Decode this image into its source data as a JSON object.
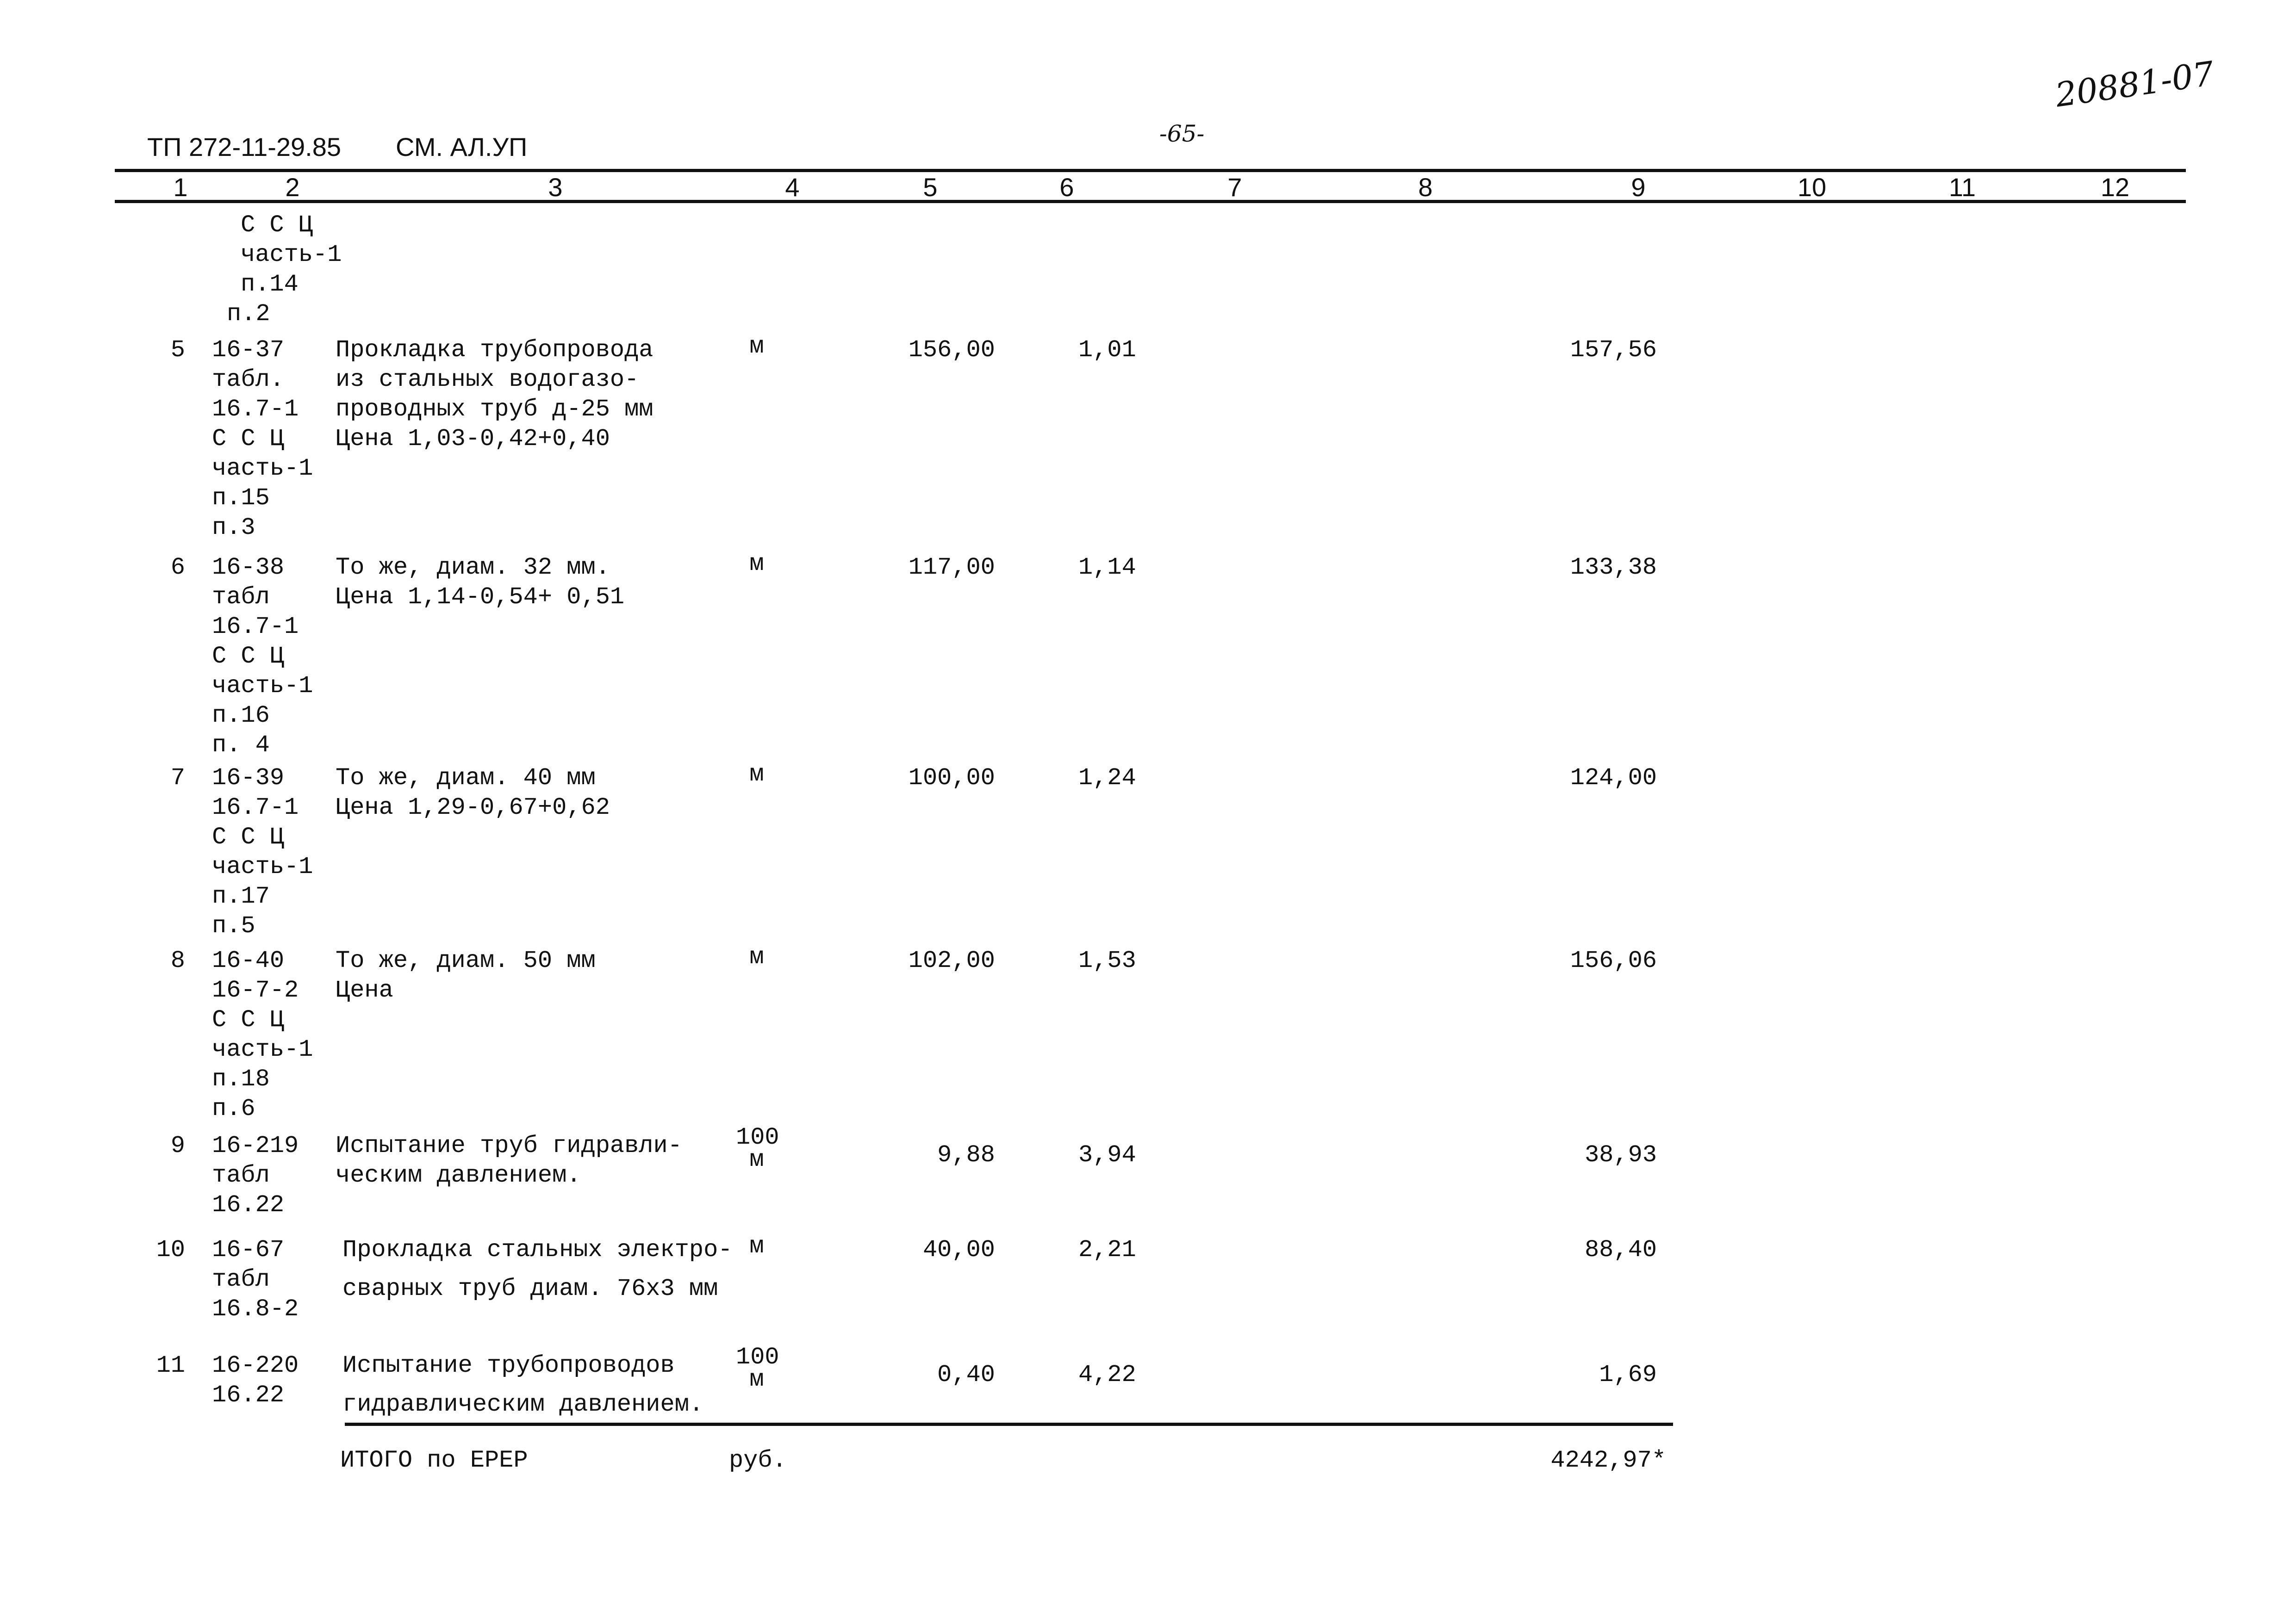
{
  "header": {
    "doc_code": "ТП 272-11-29.85",
    "section": "СМ. АЛ.УП",
    "page_number": "-65-",
    "archive_number": "20881-07"
  },
  "columns": [
    "1",
    "2",
    "3",
    "4",
    "5",
    "6",
    "7",
    "8",
    "9",
    "10",
    "11",
    "12"
  ],
  "continuation": {
    "ref_lines": [
      "С С Ц",
      "часть-1",
      "п.14",
      "п.2"
    ]
  },
  "rows": [
    {
      "num": "5",
      "ref_lines": [
        "16-37",
        "табл.",
        "16.7-1",
        "С С Ц",
        "часть-1",
        "п.15",
        "п.3"
      ],
      "desc_lines": [
        "Прокладка трубопровода",
        "из стальных водогазо-",
        "проводных труб д-25 мм",
        "Цена 1,03-0,42+0,40"
      ],
      "unit_lines": [
        "м"
      ],
      "qty": "156,00",
      "price": "1,01",
      "total": "157,56"
    },
    {
      "num": "6",
      "ref_lines": [
        "16-38",
        "табл",
        "16.7-1",
        "С С Ц",
        "часть-1",
        "п.16",
        "п. 4"
      ],
      "desc_lines": [
        "То же, диам. 32 мм.",
        "Цена 1,14-0,54+ 0,51"
      ],
      "unit_lines": [
        "м"
      ],
      "qty": "117,00",
      "price": "1,14",
      "total": "133,38"
    },
    {
      "num": "7",
      "ref_lines": [
        "16-39",
        "16.7-1",
        "С С Ц",
        "часть-1",
        "п.17",
        "п.5"
      ],
      "desc_lines": [
        "То же, диам. 40 мм",
        "Цена 1,29-0,67+0,62"
      ],
      "unit_lines": [
        "м"
      ],
      "qty": "100,00",
      "price": "1,24",
      "total": "124,00"
    },
    {
      "num": "8",
      "ref_lines": [
        "16-40",
        "16-7-2",
        "С С Ц",
        "часть-1",
        "п.18",
        "п.6"
      ],
      "desc_lines": [
        "То же, диам. 50 мм",
        "Цена"
      ],
      "unit_lines": [
        "м"
      ],
      "qty": "102,00",
      "price": "1,53",
      "total": "156,06"
    },
    {
      "num": "9",
      "ref_lines": [
        "16-219",
        "табл",
        "16.22"
      ],
      "desc_lines": [
        "Испытание труб гидравли-",
        "ческим давлением."
      ],
      "unit_lines": [
        "100",
        "м"
      ],
      "qty": "9,88",
      "price": "3,94",
      "total": "38,93"
    },
    {
      "num": "10",
      "ref_lines": [
        "16-67",
        "табл",
        "16.8-2"
      ],
      "desc_lines": [
        "Прокладка стальных электро-",
        "сварных труб диам. 76х3 мм"
      ],
      "unit_lines": [
        "м"
      ],
      "qty": "40,00",
      "price": "2,21",
      "total": "88,40"
    },
    {
      "num": "11",
      "ref_lines": [
        "16-220",
        "16.22"
      ],
      "desc_lines": [
        "Испытание трубопроводов",
        "гидравлическим давлением."
      ],
      "unit_lines": [
        "100",
        "м"
      ],
      "qty": "0,40",
      "price": "4,22",
      "total": "1,69"
    }
  ],
  "total": {
    "label": "ИТОГО по ЕРЕР",
    "unit": "руб.",
    "value": "4242,97*"
  }
}
